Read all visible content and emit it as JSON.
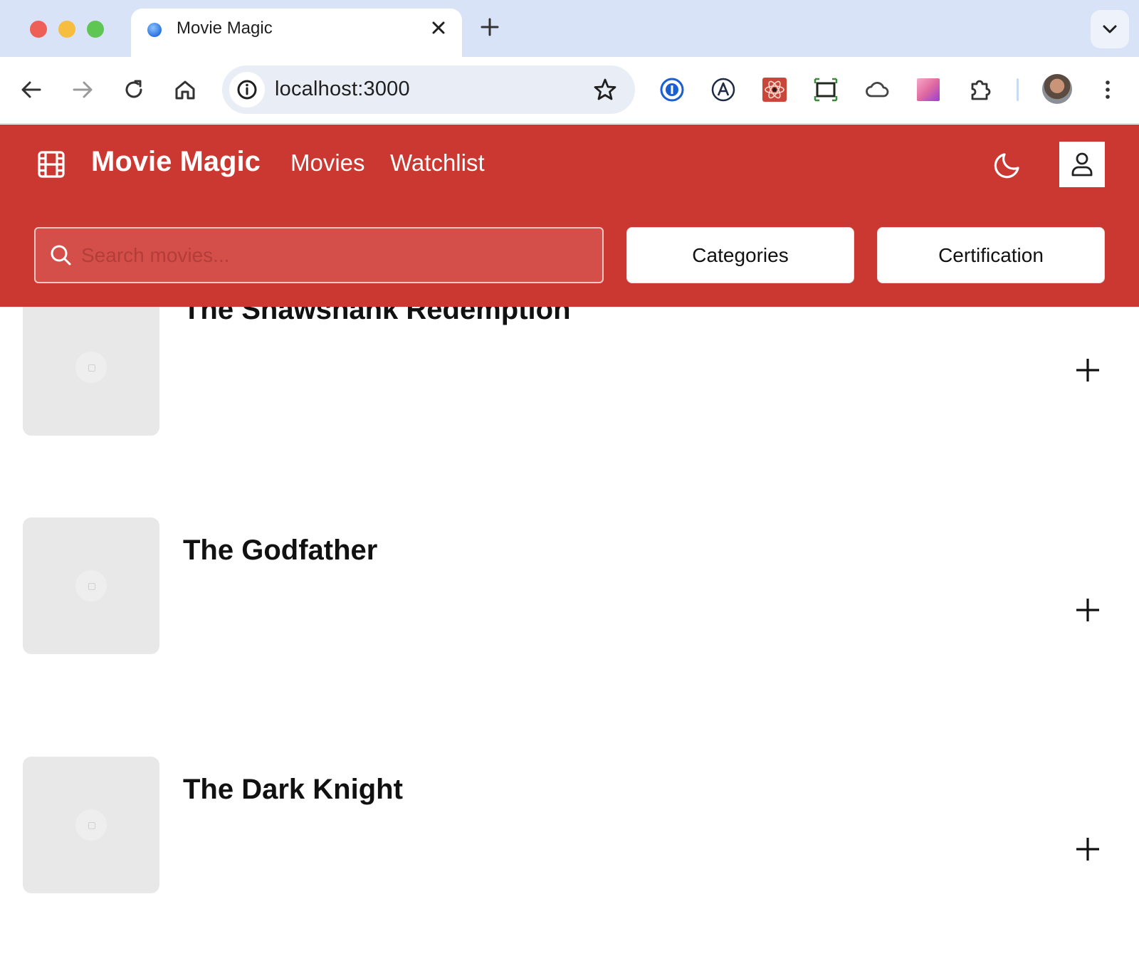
{
  "browser": {
    "tab_title": "Movie Magic",
    "url": "localhost:3000"
  },
  "app": {
    "brand": "Movie Magic",
    "nav": {
      "movies": "Movies",
      "watchlist": "Watchlist"
    },
    "search": {
      "placeholder": "Search movies..."
    },
    "filters": {
      "categories": "Categories",
      "certification": "Certification"
    },
    "colors": {
      "header_bg": "#cb3731",
      "poster_bg": "#e8e8e8"
    }
  },
  "movies": [
    {
      "title": "The Shawshank Redemption"
    },
    {
      "title": "The Godfather"
    },
    {
      "title": "The Dark Knight"
    }
  ]
}
